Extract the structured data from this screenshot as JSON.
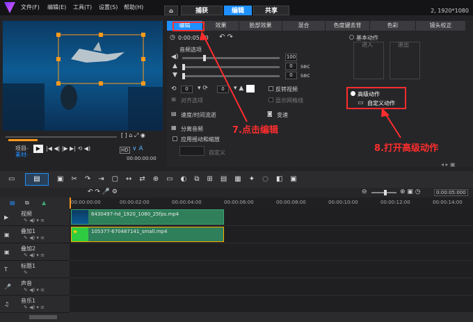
{
  "menu": [
    "文件(F)",
    "编辑(E)",
    "工具(T)",
    "设置(S)",
    "帮助(H)"
  ],
  "top_tabs": [
    "捕获",
    "编辑",
    "共享"
  ],
  "resolution": "2, 1920*1080",
  "player": {
    "project_label": "项目-",
    "clip_label": "素材-",
    "timecode": "00:00:00:00",
    "hd_badge": "HD"
  },
  "option_tabs": [
    "编辑",
    "效果",
    "脸部效果",
    "混合",
    "色度键去背",
    "色彩",
    "镜头校正"
  ],
  "duration": "0:00:05:00",
  "audio": {
    "section": "音频选项",
    "vol": "100",
    "fade_in": "0",
    "fade_out": "0",
    "unit": "sec"
  },
  "options": {
    "reverse": "反转视频",
    "align": "对齐选项",
    "grid": "显示网格线",
    "speed": "速度/时间流逝",
    "shift": "变速",
    "split_audio": "分离音频",
    "pan_zoom": "应用摇动和缩放",
    "custom": "自定义",
    "rot_a": "0",
    "rot_b": "0"
  },
  "motion": {
    "basic": "基本动作",
    "in": "进入",
    "out": "退出",
    "advanced": "高级动作",
    "custom_motion": "自定义动作"
  },
  "annotations": {
    "step7": "7.点击编辑",
    "step8": "8.打开高级动作"
  },
  "timeline": {
    "ticks": [
      "00:00:00:00",
      "00:00:02:00",
      "00:00:04:00",
      "00:00:06:00",
      "00:00:08:00",
      "00:00:10:00",
      "00:00:12:00",
      "00:00:14:00"
    ],
    "zoom_time": "0:00:05:000",
    "tracks": [
      "视频",
      "叠加1",
      "叠加2",
      "标题1",
      "声音",
      "音乐1"
    ],
    "clip_video": "6430497-hd_1920_1080_25fps.mp4",
    "clip_overlay": "105377-670487141_small.mp4"
  },
  "colors": {
    "accent": "#1e90ff",
    "annotation": "#ff2d2d",
    "handle": "#ff9a1a"
  }
}
